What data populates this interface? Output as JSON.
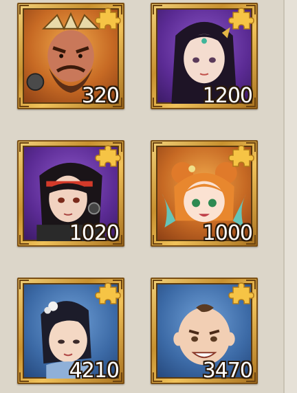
{
  "cards": [
    {
      "value": "320",
      "character": "horned-warrior",
      "background": "red"
    },
    {
      "value": "1200",
      "character": "maiden-with-tiara",
      "background": "purple"
    },
    {
      "value": "1020",
      "character": "swordsman-with-headband",
      "background": "purple"
    },
    {
      "value": "1000",
      "character": "girl-with-hair-buns",
      "background": "red"
    },
    {
      "value": "4210",
      "character": "lady-with-flower-hairpin",
      "background": "blue"
    },
    {
      "value": "3470",
      "character": "young-monk",
      "background": "blue"
    }
  ],
  "icons": {
    "badge": "puzzle-piece-icon"
  },
  "colors": {
    "page_background": "#dcd6c9",
    "frame_gold": "#c8912f",
    "puzzle_gold": "#f6c445",
    "value_text": "#ffffff",
    "value_outline": "#2b1a0a"
  }
}
